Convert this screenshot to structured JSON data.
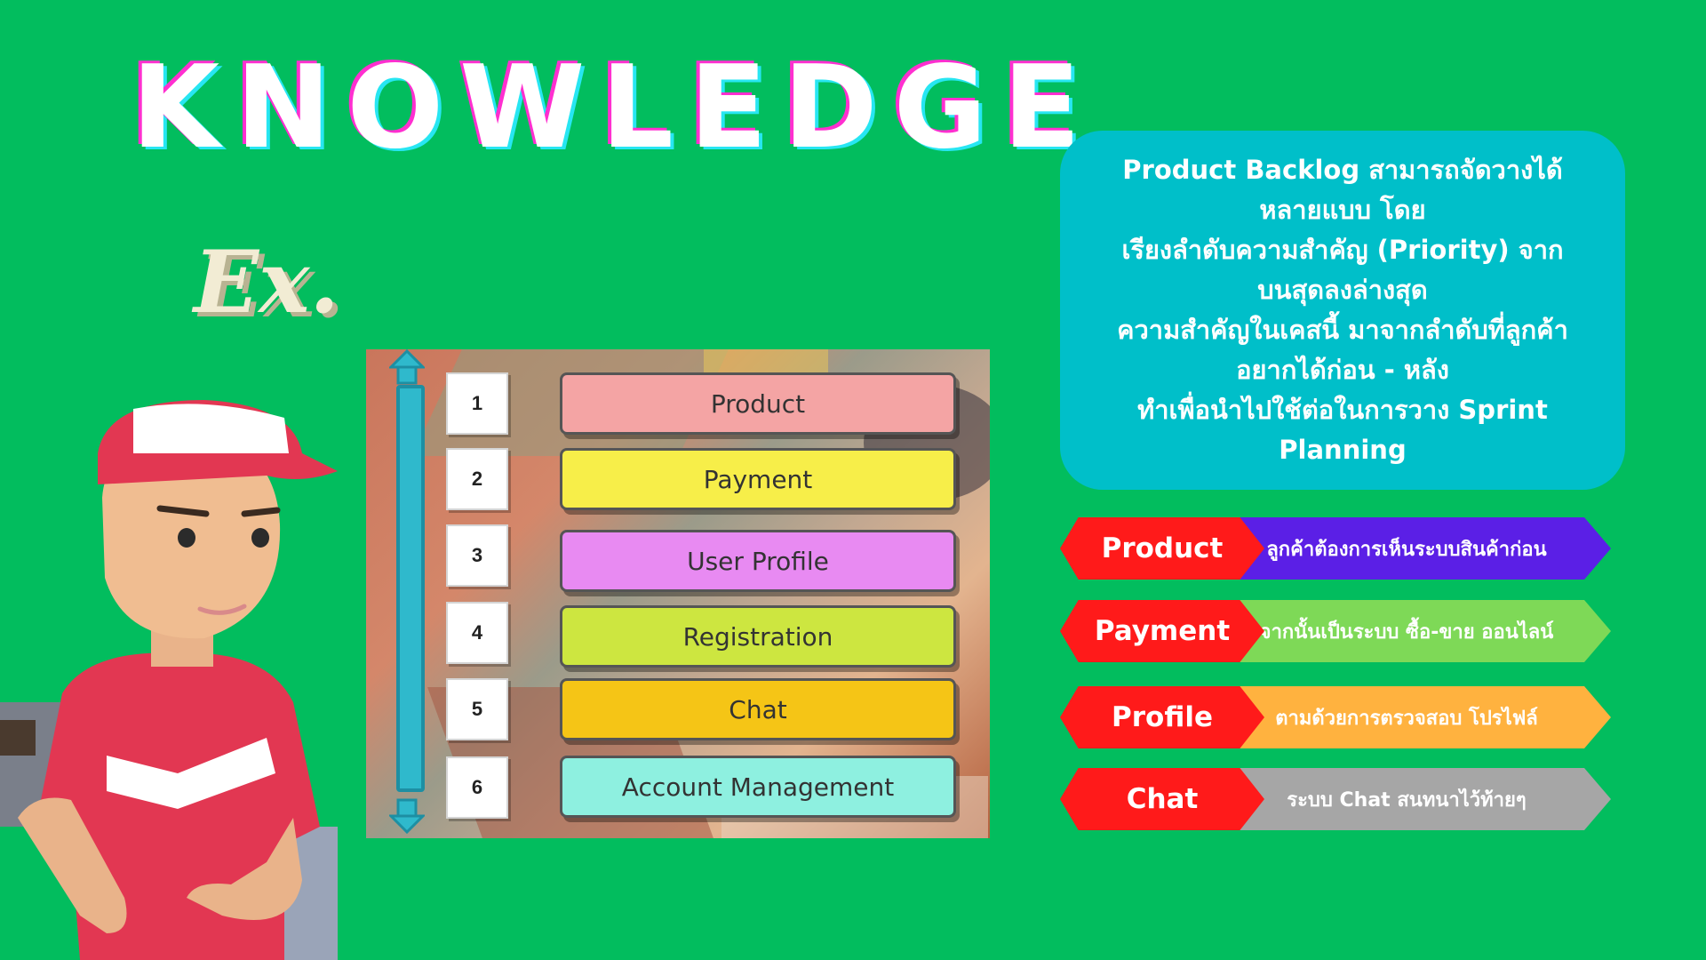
{
  "header": {
    "title": "KNOWLEDGE",
    "example_label": "Ex."
  },
  "colors": {
    "background": "#02bd5e",
    "info_box": "#00bfc9",
    "tag_label": "#ff1a1a"
  },
  "backlog": {
    "items": [
      {
        "rank": "1",
        "label": "Product",
        "color": "#f4a4a4"
      },
      {
        "rank": "2",
        "label": "Payment",
        "color": "#f7ee49"
      },
      {
        "rank": "3",
        "label": "User Profile",
        "color": "#e88af2"
      },
      {
        "rank": "4",
        "label": "Registration",
        "color": "#cde640"
      },
      {
        "rank": "5",
        "label": "Chat",
        "color": "#f5c516"
      },
      {
        "rank": "6",
        "label": "Account Management",
        "color": "#8ef0e0"
      }
    ]
  },
  "info": {
    "lines": [
      "Product Backlog สามารถจัดวางได้",
      "หลายแบบ โดย",
      "เรียงลำดับความสำคัญ (Priority) จาก",
      "บนสุดลงล่างสุด",
      "ความสำคัญในเคสนี้ มาจากลำดับที่ลูกค้า",
      "อยากได้ก่อน - หลัง",
      "ทำเพื่อนำไปใช้ต่อในการวาง Sprint",
      "Planning"
    ]
  },
  "tags": [
    {
      "label": "Product",
      "description": "ลูกค้าต้องการเห็นระบบสินค้าก่อน",
      "color": "#5b1fe6"
    },
    {
      "label": "Payment",
      "description": "จากนั้นเป็นระบบ ซื้อ-ขาย ออนไลน์",
      "color": "#7ed957"
    },
    {
      "label": "Profile",
      "description": "ตามด้วยการตรวจสอบ โปรไฟล์",
      "color": "#ffb23f"
    },
    {
      "label": "Chat",
      "description": "ระบบ Chat สนทนาไว้ท้ายๆ",
      "color": "#a6a6a6"
    }
  ]
}
